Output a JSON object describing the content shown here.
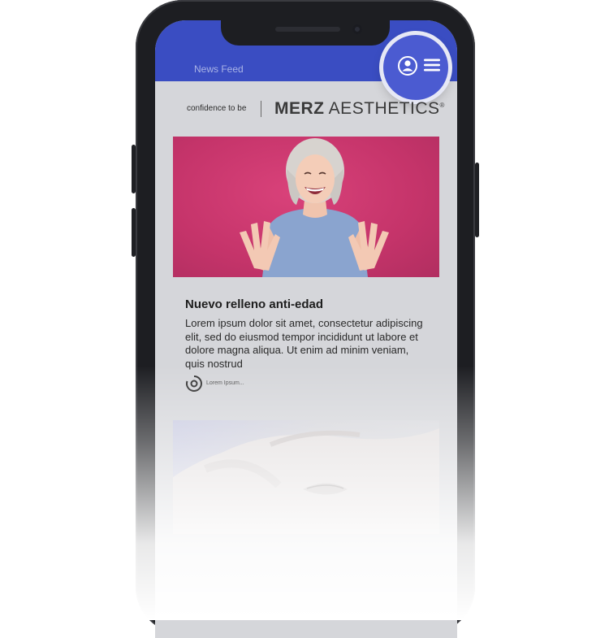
{
  "header": {
    "title": "News Feed",
    "profile_icon": "user-circle-icon",
    "menu_icon": "hamburger-menu-icon",
    "accent_color": "#3a4dc2"
  },
  "brand": {
    "tagline": "confidence to be",
    "name_bold": "MERZ",
    "name_light": " AESTHETICS",
    "registered": "®"
  },
  "article": {
    "image": "smiling-woman-photo",
    "title": "Nuevo relleno anti-edad",
    "body": "Lorem ipsum dolor sit amet, consectetur adipiscing elit, sed do eiusmod tempor incididunt ut labore et dolore magna aliqua. Ut enim ad minim veniam, quis nostrud",
    "meta_icon": "target-icon",
    "meta_text": "Lorem Ipsum..."
  },
  "next_article": {
    "image": "eye-treatment-photo"
  }
}
